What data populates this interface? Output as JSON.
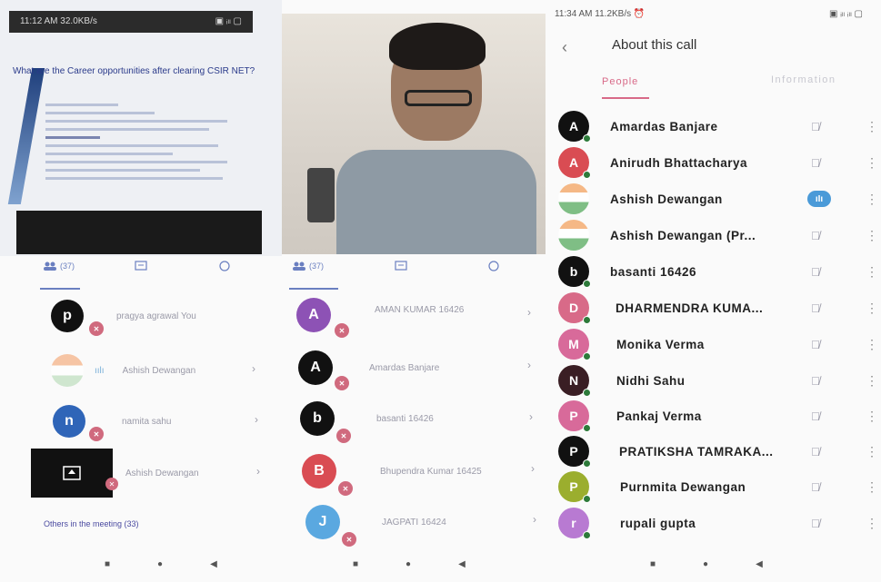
{
  "panel1": {
    "status_time": "11:12 AM 32.0KB/s",
    "status_right": "▣ ᵢₗₗ ▢",
    "doc_question": "What are the Career opportunities after clearing CSIR NET?",
    "tab_people_count": "(37)",
    "rows": [
      {
        "initial": "p",
        "name": "pragya agrawal You",
        "color": "#111111"
      },
      {
        "initial": "",
        "name": "Ashish Dewangan",
        "color": "#f3a16a"
      },
      {
        "initial": "n",
        "name": "namita sahu",
        "color": "#2f65b8"
      },
      {
        "initial": "",
        "name": "Ashish Dewangan",
        "color": "#111111"
      }
    ],
    "others_label": "Others in the meeting (33)"
  },
  "panel2": {
    "tab_people_count": "(37)",
    "rows": [
      {
        "initial": "A",
        "name": "AMAN KUMAR 16426",
        "color": "#8d52b5"
      },
      {
        "initial": "A",
        "name": "Amardas Banjare",
        "color": "#111111"
      },
      {
        "initial": "b",
        "name": "basanti 16426",
        "color": "#111111"
      },
      {
        "initial": "B",
        "name": "Bhupendra Kumar 16425",
        "color": "#d94c53"
      },
      {
        "initial": "J",
        "name": "JAGPATI 16424",
        "color": "#5aa8e0"
      }
    ]
  },
  "panel3": {
    "status_time": "11:34 AM 11.2KB/s ⏰",
    "status_right": "▣ ᵢₗₗ ᵢₗₗ ▢",
    "title": "About this call",
    "tab_people": "People",
    "tab_info": "Information",
    "participants": [
      {
        "initial": "A",
        "name": "Amardas Banjare",
        "color": "#111111",
        "speaking": false
      },
      {
        "initial": "A",
        "name": "Anirudh Bhattacharya",
        "color": "#d94c53",
        "speaking": false
      },
      {
        "initial": "",
        "name": "Ashish Dewangan",
        "color": "flag",
        "speaking": true
      },
      {
        "initial": "",
        "name": "Ashish Dewangan (Pr...",
        "color": "flag",
        "speaking": false
      },
      {
        "initial": "b",
        "name": "basanti 16426",
        "color": "#111111",
        "speaking": false
      },
      {
        "initial": "D",
        "name": "DHARMENDRA KUMA...",
        "color": "#d86a88",
        "speaking": false
      },
      {
        "initial": "M",
        "name": "Monika Verma",
        "color": "#d86a9a",
        "speaking": false
      },
      {
        "initial": "N",
        "name": "Nidhi Sahu",
        "color": "#3a1e24",
        "speaking": false
      },
      {
        "initial": "P",
        "name": "Pankaj Verma",
        "color": "#d86a9a",
        "speaking": false
      },
      {
        "initial": "P",
        "name": "PRATIKSHA TAMRAKA...",
        "color": "#111111",
        "speaking": false
      },
      {
        "initial": "P",
        "name": "Purnmita Dewangan",
        "color": "#9bae2e",
        "speaking": false
      },
      {
        "initial": "r",
        "name": "rupali gupta",
        "color": "#b87ad2",
        "speaking": false
      }
    ]
  }
}
